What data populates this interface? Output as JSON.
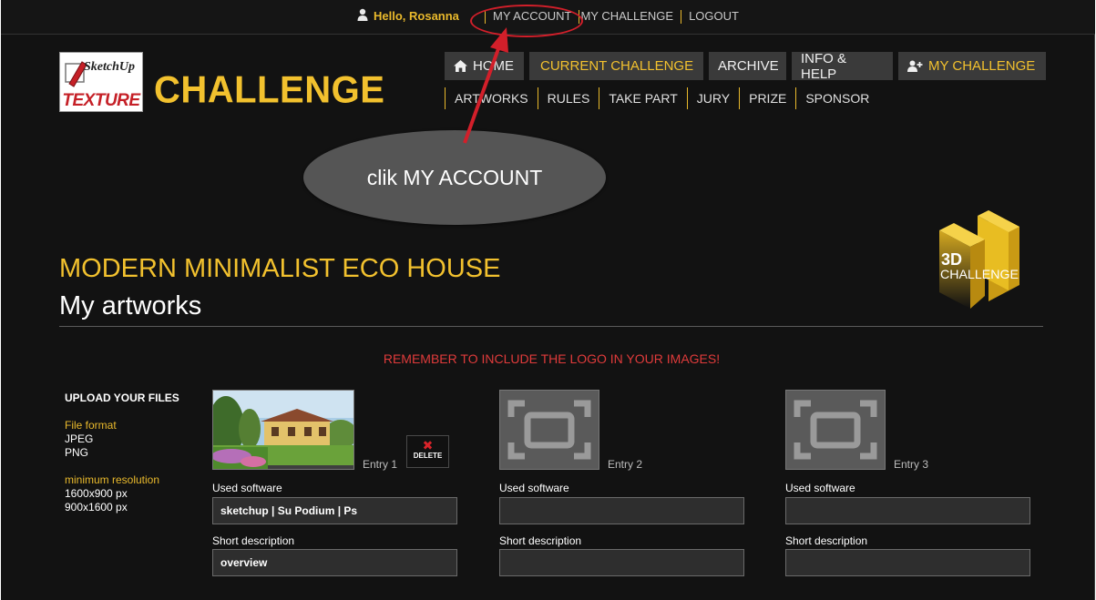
{
  "topbar": {
    "greeting": "Hello, Rosanna",
    "links": [
      "MY ACCOUNT",
      "MY CHALLENGE",
      "LOGOUT"
    ]
  },
  "annotation": {
    "bubble_text": "clik MY ACCOUNT",
    "color": "#d21f2a"
  },
  "logo": {
    "line1": "SketchUp",
    "line2": "TEXTURE"
  },
  "brand": "CHALLENGE",
  "main_nav": [
    {
      "label": "HOME",
      "icon": "home-icon"
    },
    {
      "label": "CURRENT CHALLENGE",
      "icon": ""
    },
    {
      "label": "ARCHIVE",
      "icon": ""
    },
    {
      "label": "INFO & HELP",
      "icon": ""
    },
    {
      "label": "MY CHALLENGE",
      "icon": "add-user-icon"
    }
  ],
  "sub_nav": [
    "ARTWORKS",
    "RULES",
    "TAKE PART",
    "JURY",
    "PRIZE",
    "SPONSOR"
  ],
  "badge": {
    "line1": "3D",
    "line2": "CHALLENGE"
  },
  "page": {
    "title": "MODERN MINIMALIST ECO HOUSE",
    "subtitle": "My artworks",
    "notice": "REMEMBER TO INCLUDE THE LOGO IN YOUR IMAGES!"
  },
  "upload_info": {
    "heading": "UPLOAD YOUR FILES",
    "format_label": "File format",
    "formats": [
      "JPEG",
      "PNG"
    ],
    "resolution_label": "minimum resolution",
    "resolutions": [
      "1600x900 px",
      "900x1600 px"
    ]
  },
  "entries": [
    {
      "label": "Entry 1",
      "has_image": true,
      "delete_label": "DELETE",
      "software_label": "Used software",
      "software_value": "sketchup | Su Podium | Ps",
      "desc_label": "Short description",
      "desc_value": "overview"
    },
    {
      "label": "Entry 2",
      "has_image": false,
      "software_label": "Used software",
      "software_value": "",
      "desc_label": "Short description",
      "desc_value": ""
    },
    {
      "label": "Entry 3",
      "has_image": false,
      "software_label": "Used software",
      "software_value": "",
      "desc_label": "Short description",
      "desc_value": ""
    }
  ],
  "colors": {
    "gold": "#f2c12e",
    "background": "#121212",
    "button": "#3a3a3a",
    "notice": "#e03b3b"
  }
}
